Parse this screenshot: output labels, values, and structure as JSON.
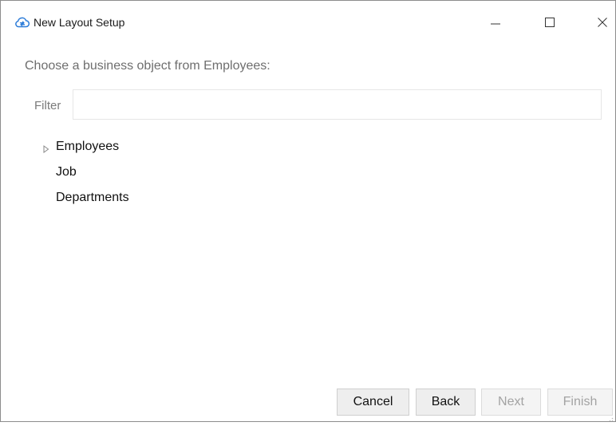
{
  "window": {
    "title": "New Layout Setup",
    "icon": "cloud-sync-icon",
    "controls": [
      "minimize-icon",
      "maximize-icon",
      "close-icon"
    ]
  },
  "prompt": "Choose a business object from Employees:",
  "filter": {
    "label": "Filter",
    "value": "",
    "placeholder": ""
  },
  "tree": {
    "items": [
      {
        "label": "Employees",
        "expandable": true
      },
      {
        "label": "Job",
        "expandable": false
      },
      {
        "label": "Departments",
        "expandable": false
      }
    ]
  },
  "buttons": {
    "cancel": "Cancel",
    "back": "Back",
    "next": "Next",
    "finish": "Finish"
  },
  "colors": {
    "accent": "#2b7bd8",
    "disabled_text": "#a3a3a3"
  }
}
